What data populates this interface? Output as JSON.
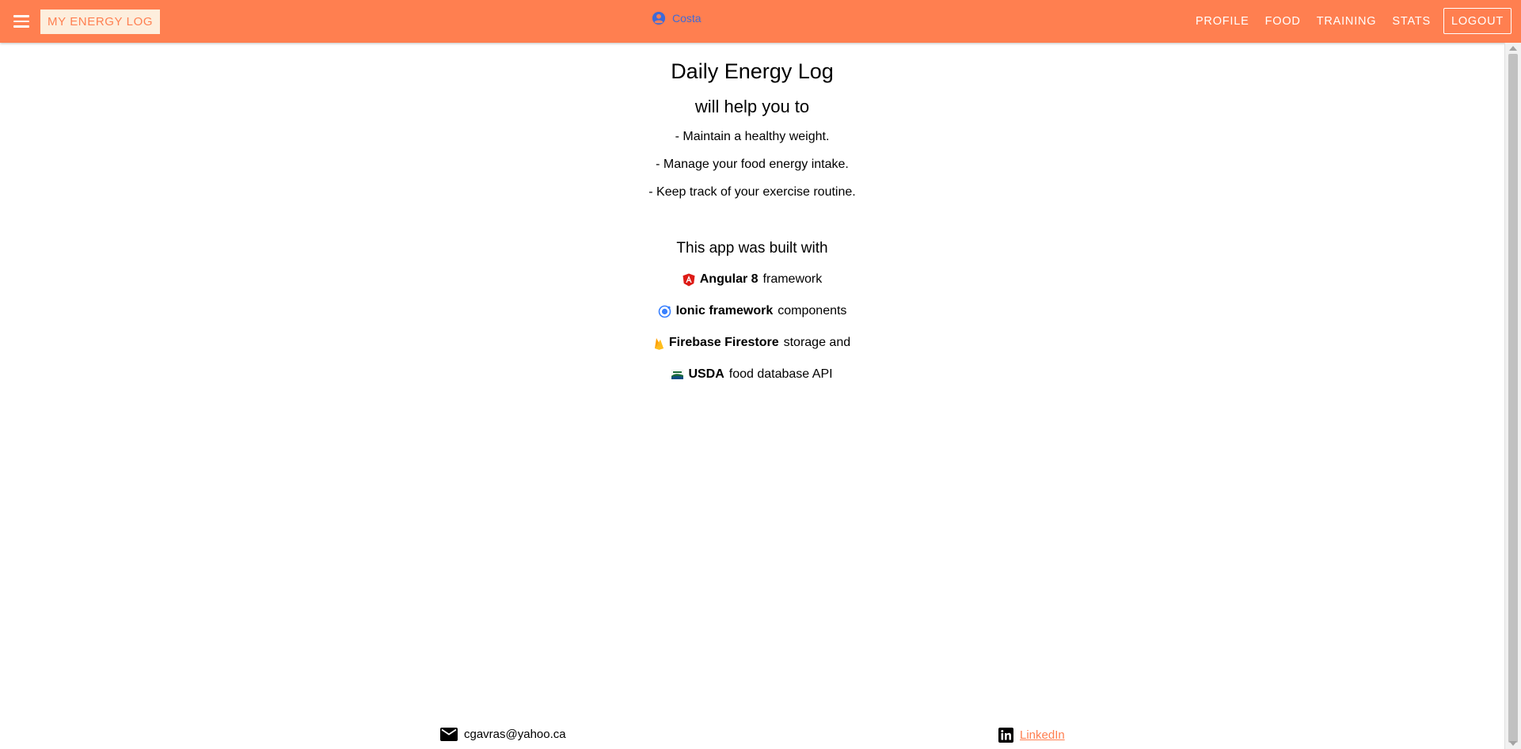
{
  "toolbar": {
    "menu_icon": "menu-icon",
    "brand": "MY ENERGY LOG",
    "user_name": "Costa",
    "user_icon": "person-circle-icon",
    "nav": [
      {
        "label": "PROFILE"
      },
      {
        "label": "FOOD"
      },
      {
        "label": "TRAINING"
      },
      {
        "label": "STATS"
      },
      {
        "label": "LOGOUT"
      }
    ],
    "colors": {
      "background": "#ff7f50",
      "brand_bg": "#fdeedd",
      "user": "#3f6ad8"
    }
  },
  "main": {
    "title": "Daily Energy Log",
    "subtitle": "will help you to",
    "bullets": [
      "- Maintain a healthy weight.",
      "- Manage your food energy intake.",
      "- Keep track of your exercise routine."
    ],
    "built_with": "This app was built with",
    "tech": [
      {
        "icon": "angular-icon",
        "bold": "Angular 8",
        "rest": "framework"
      },
      {
        "icon": "ionic-icon",
        "bold": "Ionic framework",
        "rest": "components"
      },
      {
        "icon": "firebase-icon",
        "bold": "Firebase Firestore",
        "rest": "storage and"
      },
      {
        "icon": "usda-icon",
        "bold": "USDA",
        "rest": "food database API"
      }
    ]
  },
  "footer": {
    "email": "cgavras@yahoo.ca",
    "email_icon": "mail-icon",
    "linkedin": "LinkedIn",
    "linkedin_icon": "linkedin-icon"
  }
}
